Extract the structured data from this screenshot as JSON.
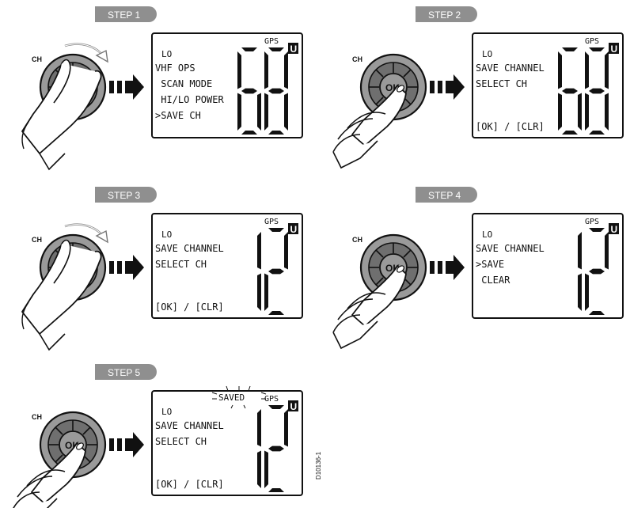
{
  "labels": {
    "ch": "CH",
    "ok": "OK",
    "gps": "GPS",
    "u": "U",
    "saved": "SAVED",
    "ref": "D10136-1"
  },
  "steps": [
    {
      "label": "STEP  1",
      "rotate": true,
      "lcd": {
        "lo": "LO",
        "lines": [
          "VHF OPS",
          " SCAN MODE",
          " HI/LO POWER",
          ">SAVE CH"
        ],
        "channel": "68",
        "saved": false
      }
    },
    {
      "label": "STEP  2",
      "rotate": false,
      "lcd": {
        "lo": "LO",
        "lines": [
          "SAVE CHANNEL",
          "SELECT CH",
          "",
          "",
          "[OK] / [CLR]"
        ],
        "channel": "68",
        "saved": false
      }
    },
    {
      "label": "STEP  3",
      "rotate": true,
      "lcd": {
        "lo": "LO",
        "lines": [
          "SAVE CHANNEL",
          "SELECT CH",
          "",
          "",
          "[OK] / [CLR]"
        ],
        "channel": "12",
        "saved": false
      }
    },
    {
      "label": "STEP  4",
      "rotate": false,
      "lcd": {
        "lo": "LO",
        "lines": [
          "SAVE CHANNEL",
          ">SAVE",
          " CLEAR"
        ],
        "channel": "12",
        "saved": false
      }
    },
    {
      "label": "STEP  5",
      "rotate": false,
      "lcd": {
        "lo": "LO",
        "lines": [
          "SAVE CHANNEL",
          "SELECT CH",
          "",
          "",
          "[OK] / [CLR]"
        ],
        "channel": "12",
        "saved": true
      }
    }
  ]
}
